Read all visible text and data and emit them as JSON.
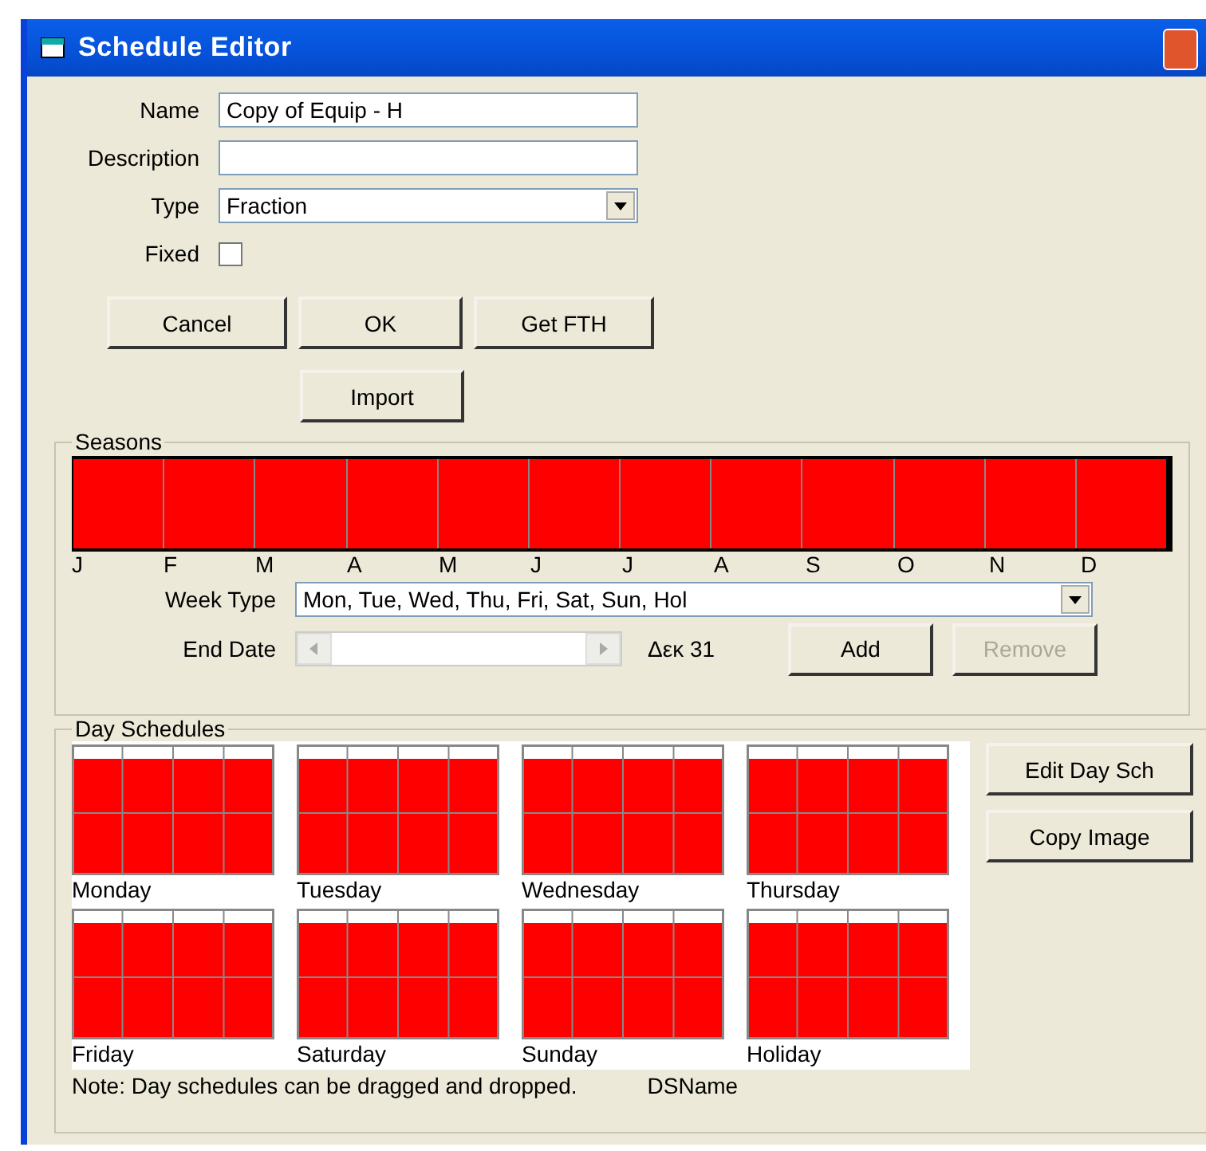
{
  "window": {
    "title": "Schedule Editor"
  },
  "form": {
    "name_label": "Name",
    "name_value": "Copy of Equip - H",
    "description_label": "Description",
    "type_label": "Type",
    "type_value": "Fraction",
    "fixed_label": "Fixed",
    "fixed_checked": false
  },
  "buttons": [
    {
      "label": "Cancel",
      "disabled": false
    },
    {
      "label": "OK",
      "disabled": false
    },
    {
      "label": "Get FTH",
      "disabled": false
    }
  ],
  "import_button": {
    "label": "Import",
    "disabled": false
  },
  "seasons": {
    "title": "Seasons",
    "months": [
      "J",
      "F",
      "M",
      "A",
      "M",
      "J",
      "J",
      "A",
      "S",
      "O",
      "N",
      "D"
    ],
    "week_type_label": "Week Type",
    "week_type_value": "Mon, Tue, Wed, Thu, Fri, Sat, Sun, Hol",
    "end_date_label": "End Date",
    "end_date_value": "Δεκ 31",
    "buttons": [
      {
        "label": "Add",
        "disabled": false
      },
      {
        "label": "Remove",
        "disabled": true
      }
    ]
  },
  "day_schedules": {
    "title": "Day Schedules",
    "days": [
      "Monday",
      "Tuesday",
      "Wednesday",
      "Thursday",
      "Friday",
      "Saturday",
      "Sunday",
      "Holiday"
    ],
    "buttons": [
      {
        "label": "Edit Day Sch",
        "disabled": false
      },
      {
        "label": "Copy Image",
        "disabled": false
      }
    ],
    "note": "Note: Day schedules can be dragged and dropped.",
    "ds_name": "DSName"
  }
}
